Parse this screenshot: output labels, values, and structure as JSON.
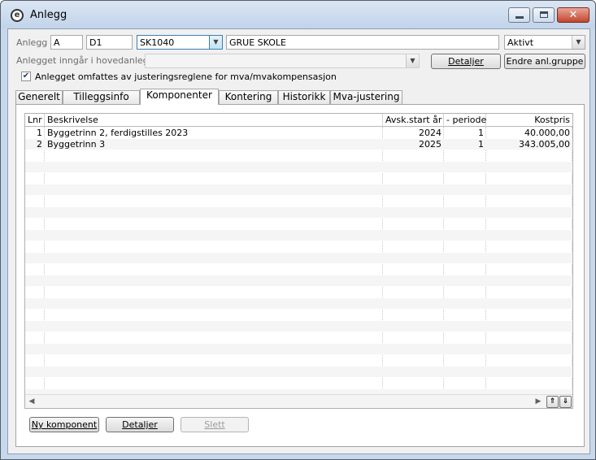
{
  "window": {
    "title": "Anlegg"
  },
  "header": {
    "anlegg_label": "Anlegg",
    "field_a": "A",
    "field_d1": "D1",
    "code_value": "SK1040",
    "name_value": "GRUE SKOLE",
    "status_value": "Aktivt",
    "parent_label": "Anlegget inngår i hovedanlegg",
    "parent_value": "",
    "detaljer_button": "Detaljer",
    "endre_button": "Endre anl.gruppe",
    "checkbox_label": "Anlegget omfattes av justeringsreglene for mva/mvakompensasjon",
    "checkbox_checked": true
  },
  "tabs": [
    {
      "label": "Generelt"
    },
    {
      "label": "Tilleggsinfo"
    },
    {
      "label": "Komponenter",
      "active": true
    },
    {
      "label": "Kontering"
    },
    {
      "label": "Historikk"
    },
    {
      "label": "Mva-justering"
    }
  ],
  "table": {
    "columns": [
      "Lnr",
      "Beskrivelse",
      "Avsk.start år",
      "- periode",
      "Kostpris"
    ],
    "rows": [
      {
        "lnr": "1",
        "beskrivelse": "Byggetrinn 2, ferdigstilles 2023",
        "avsk_start": "2024",
        "periode": "1",
        "kostpris": "40.000,00"
      },
      {
        "lnr": "2",
        "beskrivelse": "Byggetrinn 3",
        "avsk_start": "2025",
        "periode": "1",
        "kostpris": "343.005,00"
      }
    ]
  },
  "footer": {
    "ny_komponent": "Ny komponent",
    "detaljer": "Detaljer",
    "slett": "Slett"
  }
}
